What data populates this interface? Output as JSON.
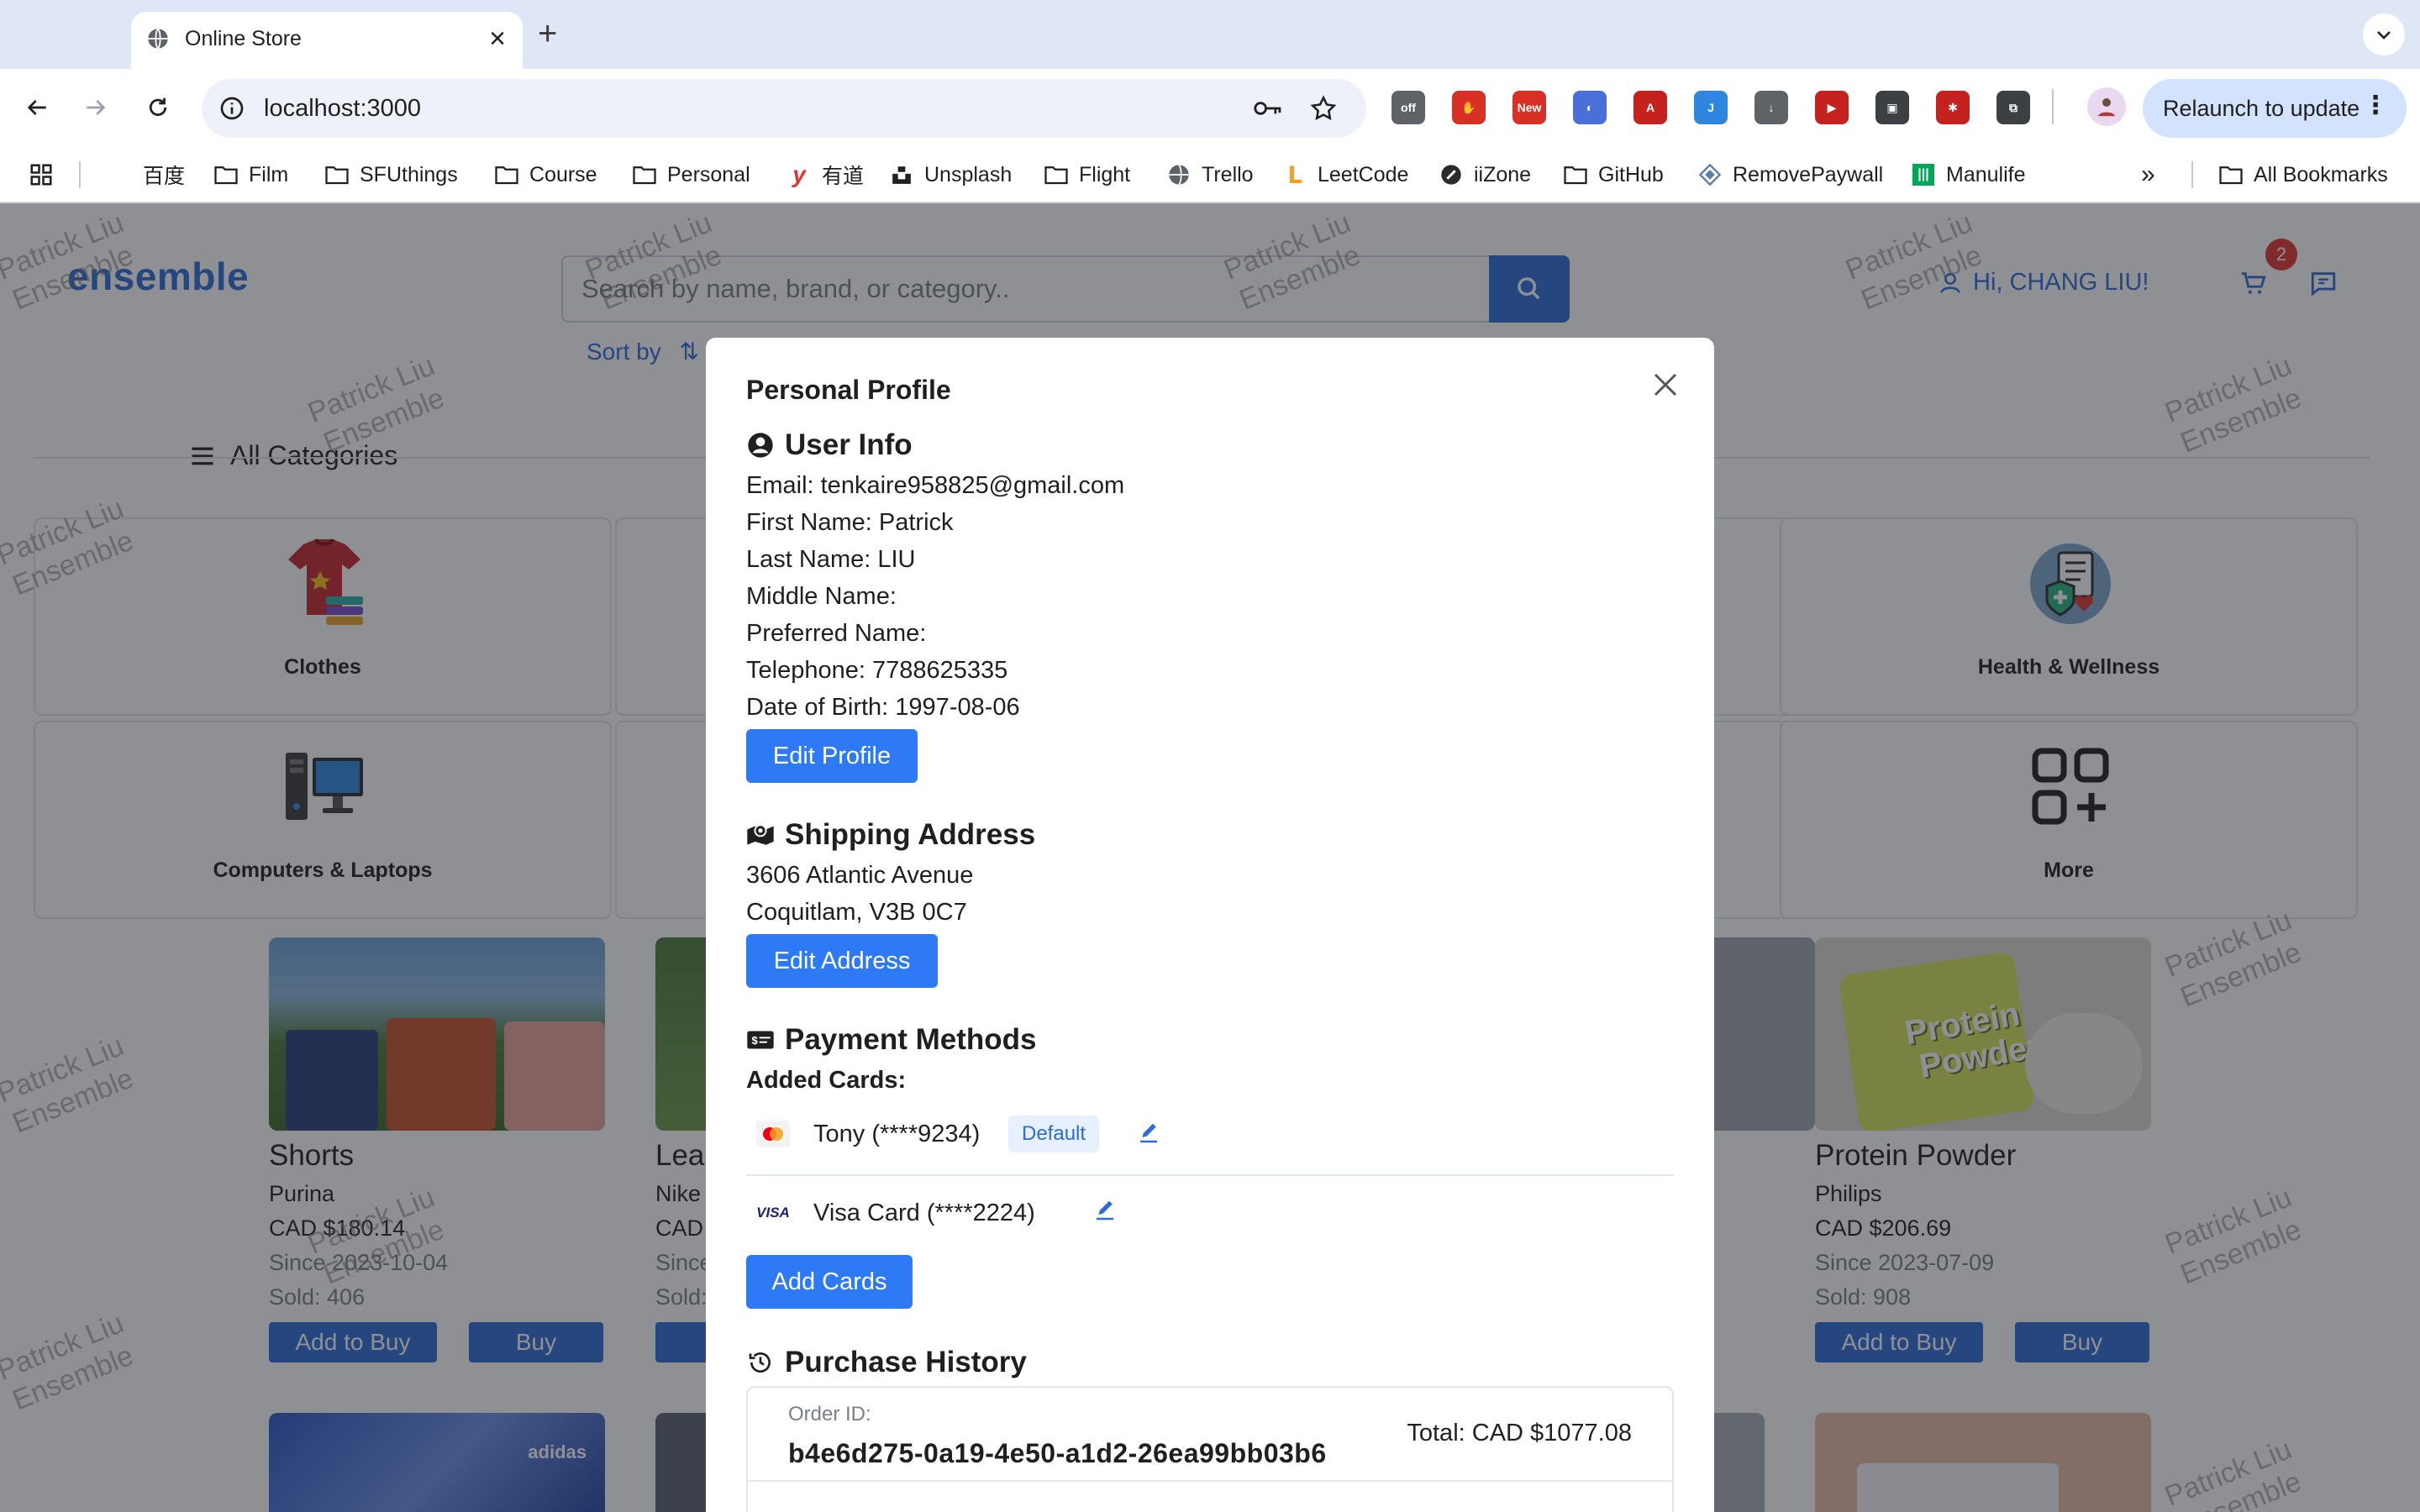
{
  "browser": {
    "tab_title": "Online Store",
    "tab_close": "×",
    "new_tab": "+",
    "url": "localhost:3000",
    "relaunch_label": "Relaunch to update",
    "relaunch_dots": "⋮",
    "extensions": [
      {
        "name": "off-ext",
        "text": "off",
        "color": "#5f6368"
      },
      {
        "name": "adblock-ext",
        "text": "✋",
        "color": "#d93025"
      },
      {
        "name": "new-ext",
        "text": "New",
        "color": "#d93025"
      },
      {
        "name": "moon-ext",
        "text": "◐",
        "color": "#4a6fd8"
      },
      {
        "name": "pdf-ext",
        "text": "A",
        "color": "#c5221f"
      },
      {
        "name": "curve-ext",
        "text": "J",
        "color": "#2e86de"
      },
      {
        "name": "download-ext",
        "text": "↓",
        "color": "#5f6368"
      },
      {
        "name": "youtube-ext",
        "text": "▶",
        "color": "#c5221f"
      },
      {
        "name": "box-ext",
        "text": "▣",
        "color": "#3c4043"
      },
      {
        "name": "bug-ext",
        "text": "✱",
        "color": "#c5221f"
      },
      {
        "name": "puzzle-ext",
        "text": "⧉",
        "color": "#3c4043"
      }
    ],
    "bookmarks": [
      {
        "label": "百度",
        "icon": "none"
      },
      {
        "label": "Film",
        "icon": "folder-icon"
      },
      {
        "label": "SFUthings",
        "icon": "folder-icon"
      },
      {
        "label": "Course",
        "icon": "folder-icon"
      },
      {
        "label": "Personal",
        "icon": "folder-icon"
      },
      {
        "label": "有道",
        "icon": "youdao-icon"
      },
      {
        "label": "Unsplash",
        "icon": "unsplash-icon"
      },
      {
        "label": "Flight",
        "icon": "folder-icon"
      },
      {
        "label": "Trello",
        "icon": "globe-icon"
      },
      {
        "label": "LeetCode",
        "icon": "leetcode-icon"
      },
      {
        "label": "iiZone",
        "icon": "iizone-icon"
      },
      {
        "label": "GitHub",
        "icon": "folder-icon"
      },
      {
        "label": "RemovePaywall",
        "icon": "removepaywall-icon"
      },
      {
        "label": "Manulife",
        "icon": "manulife-icon"
      }
    ],
    "bookmarks_overflow": "»",
    "all_bookmarks": "All Bookmarks"
  },
  "store": {
    "logo": "ensemble",
    "search_placeholder": "Search by name, brand, or category..",
    "sort_label": "Sort by",
    "greeting": "Hi, CHANG LIU!",
    "cart_count": "2",
    "all_categories": "All Categories",
    "categories": [
      {
        "label": "Clothes"
      },
      {
        "label": "Health & Wellness"
      },
      {
        "label": "Computers & Laptops"
      },
      {
        "label": "More"
      }
    ],
    "products": [
      {
        "name": "Shorts",
        "brand": "Purina",
        "price": "CAD $180.14",
        "since": "Since 2023-10-04",
        "sold": "Sold: 406",
        "add": "Add to Buy",
        "buy": "Buy"
      },
      {
        "name": "Lea",
        "brand": "Nike",
        "price": "CAD",
        "since": "Since",
        "sold": "Sold:",
        "add": "Ad",
        "buy": ""
      },
      {
        "name": "Protein Powder",
        "brand": "Philips",
        "price": "CAD $206.69",
        "since": "Since 2023-07-09",
        "sold": "Sold: 908",
        "add": "Add to Buy",
        "buy": "Buy"
      }
    ],
    "protein_label_1": "Protein",
    "protein_label_2": "Powder",
    "adidas_label": "adidas",
    "watermark_1": "Patrick Liu",
    "watermark_2": "Ensemble"
  },
  "modal": {
    "title": "Personal Profile",
    "user_info": {
      "heading": "User Info",
      "email": "Email: tenkaire958825@gmail.com",
      "first_name": "First Name: Patrick",
      "last_name": "Last Name: LIU",
      "middle_name": "Middle Name:",
      "preferred_name": "Preferred Name:",
      "telephone": "Telephone: 7788625335",
      "dob": "Date of Birth: 1997-08-06",
      "edit_button": "Edit Profile"
    },
    "shipping": {
      "heading": "Shipping Address",
      "line1": "3606 Atlantic Avenue",
      "line2": "Coquitlam, V3B 0C7",
      "edit_button": "Edit Address"
    },
    "payment": {
      "heading": "Payment Methods",
      "added_cards_label": "Added Cards:",
      "cards": [
        {
          "label": "Tony (****9234)",
          "brand": "mastercard",
          "default": "Default"
        },
        {
          "label": "Visa Card (****2224)",
          "brand": "visa",
          "brand_text": "VISA"
        }
      ],
      "add_button": "Add Cards"
    },
    "purchase_history": {
      "heading": "Purchase History",
      "order_id_label": "Order ID:",
      "order_id": "b4e6d275-0a19-4e50-a1d2-26ea99bb03b6",
      "total": "Total: CAD $1077.08"
    }
  },
  "colors": {
    "brand": "#2e6bd6",
    "button": "#2e7af6",
    "badge": "#e0322f"
  }
}
